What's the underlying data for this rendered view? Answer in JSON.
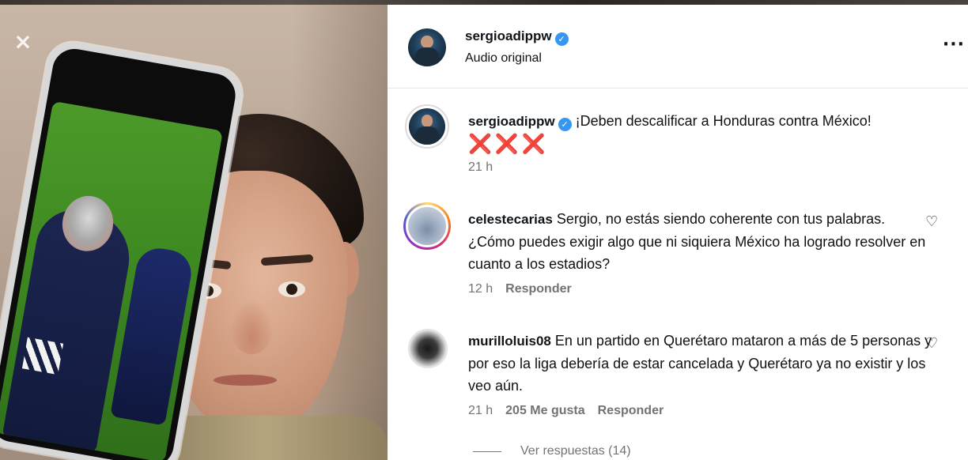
{
  "post": {
    "username": "sergioadippw",
    "audio": "Audio original",
    "caption": "¡Deben descalificar a Honduras contra México!",
    "caption_emoji": "❌❌❌",
    "caption_time": "21 h"
  },
  "comments": [
    {
      "username": "celestecarias",
      "text": "Sergio, no estás siendo coherente con tus palabras. ¿Cómo puedes exigir algo que ni siquiera México ha logrado resolver en cuanto a los estadios?",
      "time": "12 h",
      "reply_label": "Responder"
    },
    {
      "username": "murilloluis08",
      "text": "En un partido en Querétaro mataron a más de 5 personas y por eso la liga debería de estar cancelada y Querétaro ya no existir y los veo aún.",
      "time": "21 h",
      "likes": "205 Me gusta",
      "reply_label": "Responder",
      "view_replies": "Ver respuestas (14)"
    }
  ],
  "icons": {
    "verified": "verified-badge-icon",
    "more": "more-options-icon",
    "heart": "heart-outline-icon",
    "watermark": "capcut-logo-icon"
  },
  "colors": {
    "verified_blue": "#3797f0",
    "meta_gray": "#737373",
    "x_red": "#d63b2f"
  }
}
